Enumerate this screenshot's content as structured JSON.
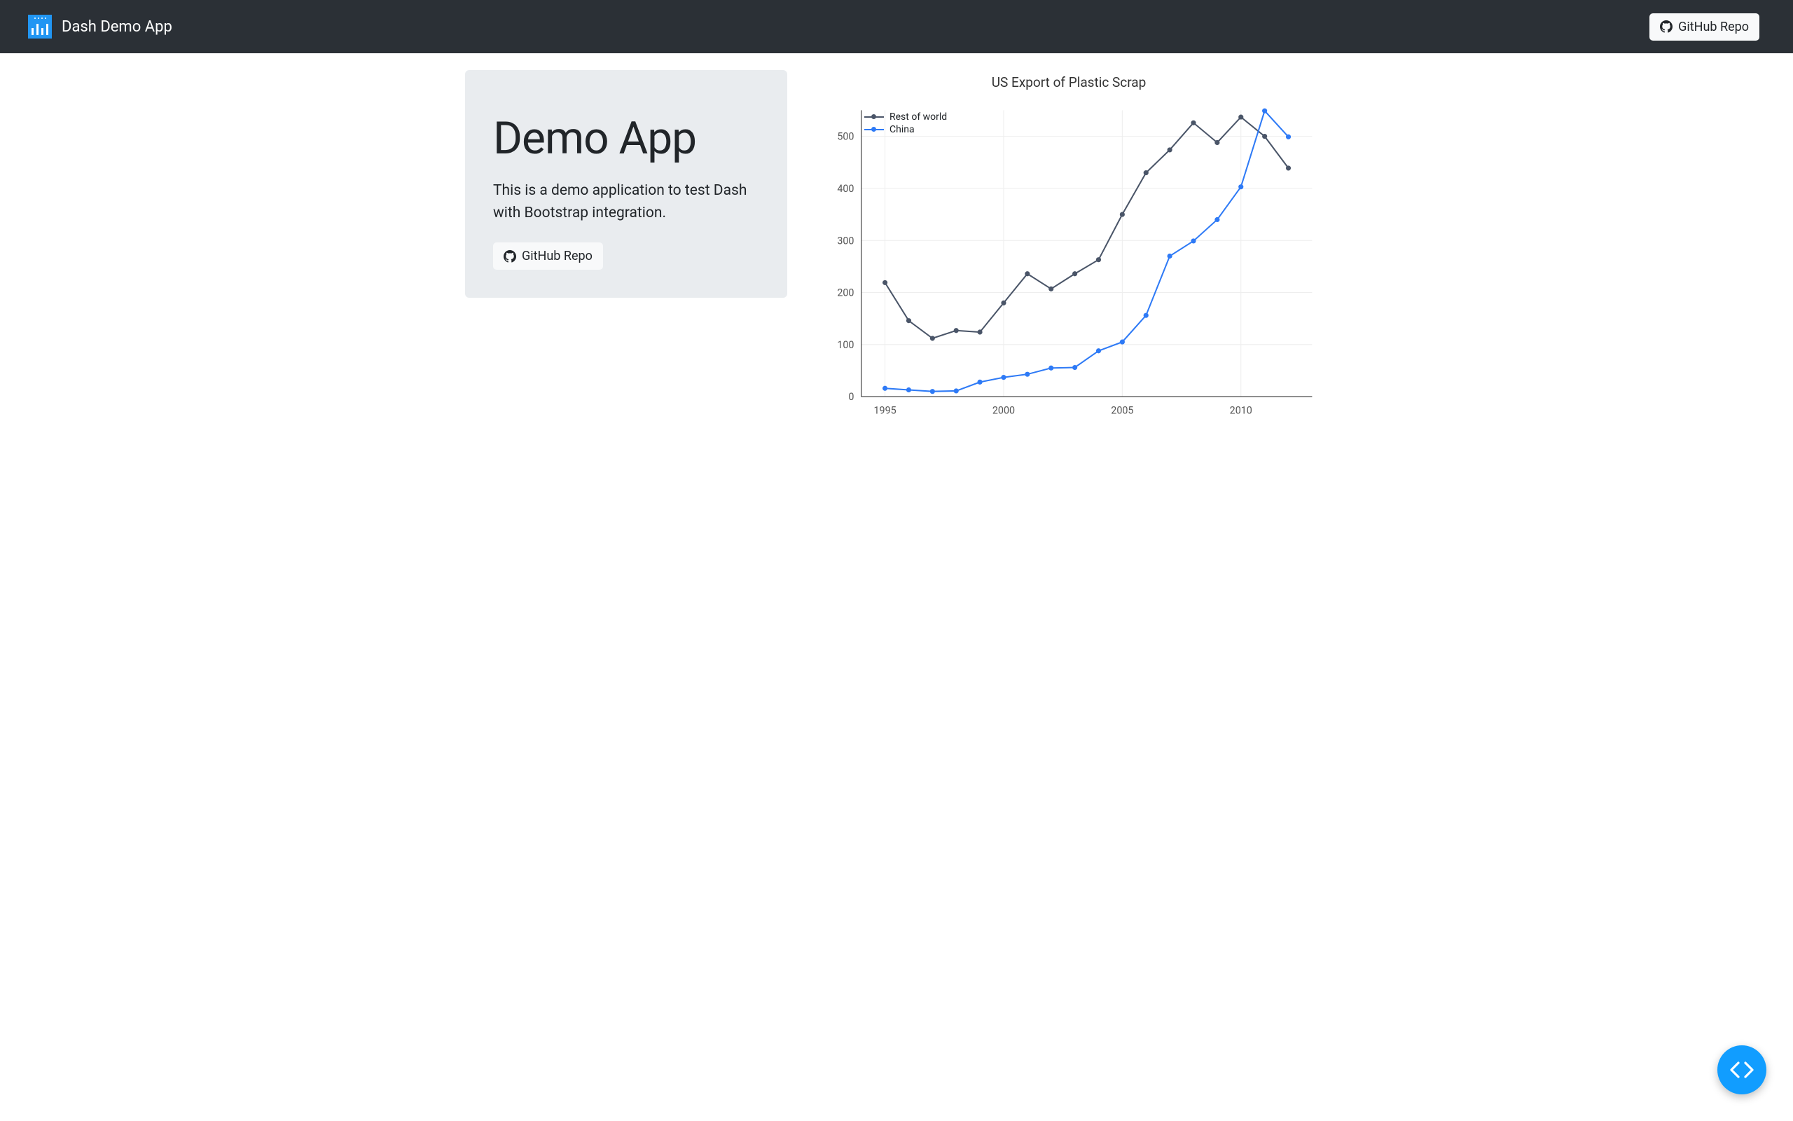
{
  "navbar": {
    "title": "Dash Demo App",
    "github_label": "GitHub Repo"
  },
  "jumbotron": {
    "heading": "Demo App",
    "lead": "This is a demo application to test Dash with Bootstrap integration.",
    "button_label": "GitHub Repo"
  },
  "chart_data": {
    "type": "line",
    "title": "US Export of Plastic Scrap",
    "xlabel": "",
    "ylabel": "",
    "xlim": [
      1994,
      2013
    ],
    "ylim": [
      0,
      550
    ],
    "yticks": [
      0,
      100,
      200,
      300,
      400,
      500
    ],
    "x": [
      1995,
      1996,
      1997,
      1998,
      1999,
      2000,
      2001,
      2002,
      2003,
      2004,
      2005,
      2006,
      2007,
      2008,
      2009,
      2010,
      2011,
      2012
    ],
    "series": [
      {
        "name": "Rest of world",
        "color": "#4a5568",
        "values": [
          219,
          146,
          112,
          127,
          124,
          180,
          236,
          207,
          236,
          263,
          350,
          430,
          474,
          526,
          488,
          537,
          500,
          439
        ]
      },
      {
        "name": "China",
        "color": "#2e7af6",
        "values": [
          16,
          13,
          10,
          11,
          28,
          37,
          43,
          55,
          56,
          88,
          105,
          156,
          270,
          299,
          340,
          403,
          549,
          499
        ]
      }
    ]
  },
  "colors": {
    "navbar_bg": "#2b3036",
    "accent": "#2196f3",
    "fab": "#119dff"
  }
}
